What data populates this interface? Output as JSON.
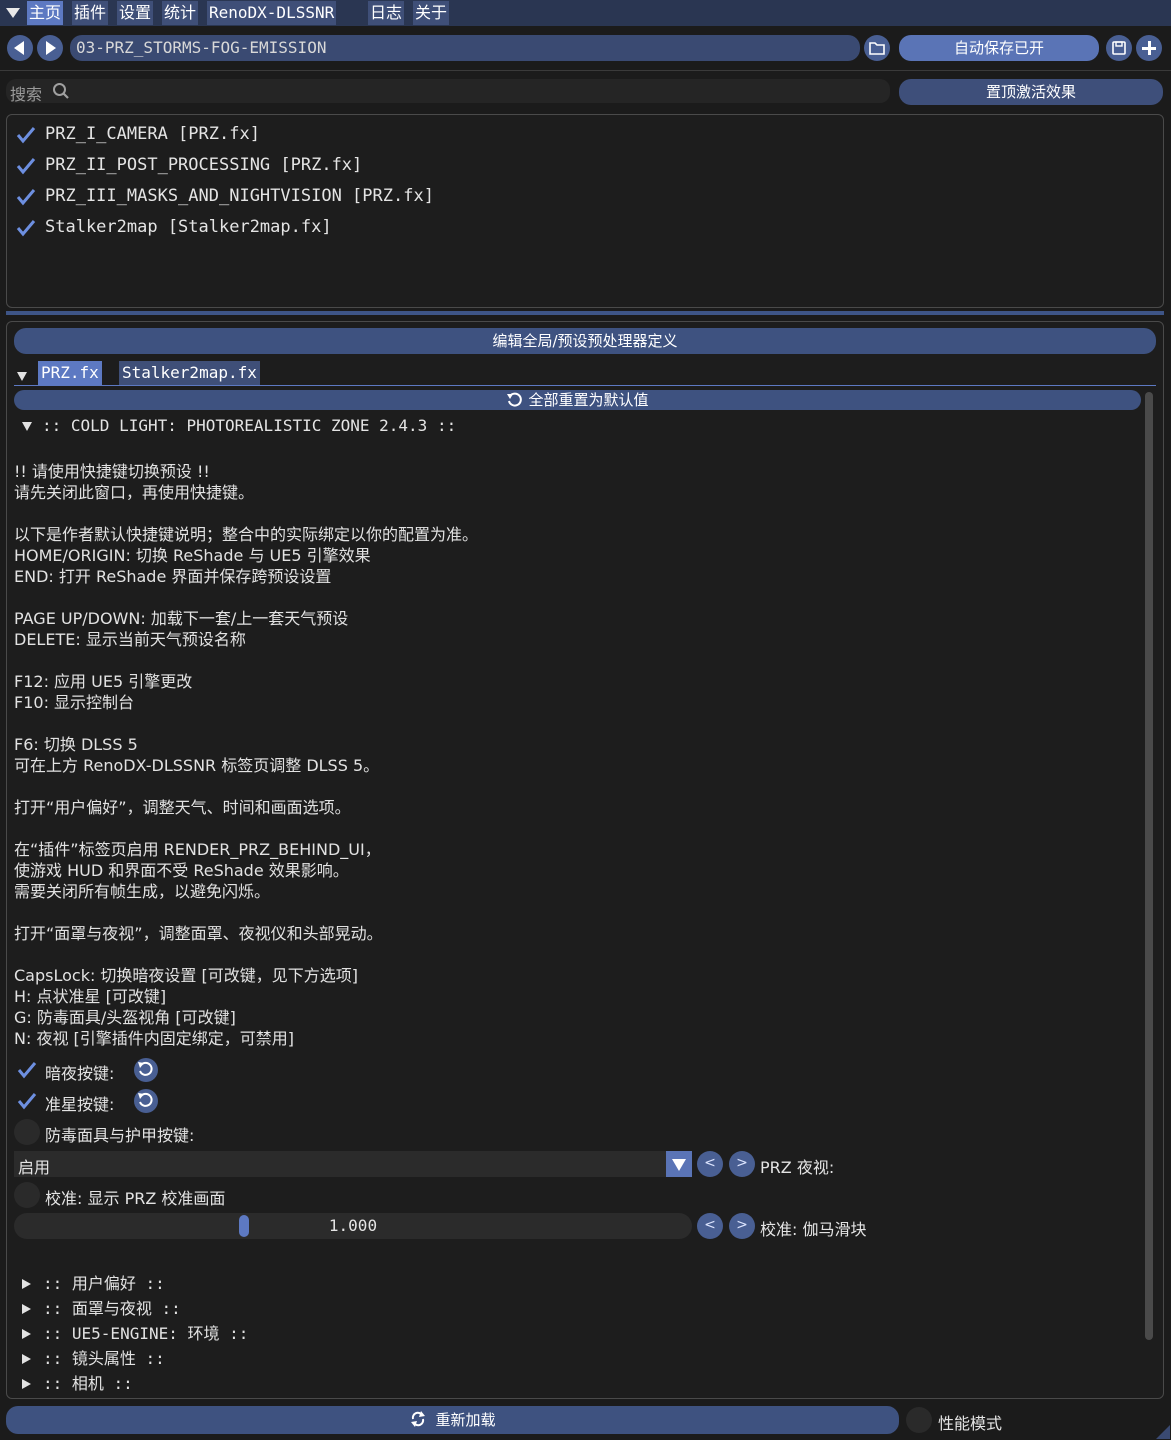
{
  "menu": {
    "tabs": [
      "主页",
      "插件",
      "设置",
      "统计",
      "RenoDX-DLSSNR",
      "日志",
      "关于"
    ],
    "active_tab": "主页"
  },
  "preset": {
    "name": "03-PRZ_STORMS-FOG-EMISSION",
    "autosave_label": "自动保存已开"
  },
  "search": {
    "label": "搜索",
    "placeholder": "",
    "pin_active_label": "置顶激活效果"
  },
  "effects": [
    {
      "label": "PRZ_I_CAMERA [PRZ.fx]",
      "checked": true
    },
    {
      "label": "PRZ_II_POST_PROCESSING [PRZ.fx]",
      "checked": true
    },
    {
      "label": "PRZ_III_MASKS_AND_NIGHTVISION [PRZ.fx]",
      "checked": true
    },
    {
      "label": "Stalker2map [Stalker2map.fx]",
      "checked": true
    }
  ],
  "editor": {
    "edit_defines_label": "编辑全局/预设预处理器定义",
    "file_tabs": [
      "PRZ.fx",
      "Stalker2map.fx"
    ],
    "active_file_tab": "PRZ.fx",
    "reset_all_label": "全部重置为默认值",
    "section_title": ":: COLD LIGHT: PHOTOREALISTIC ZONE 2.4.3 ::",
    "info_lines": [
      "!! 请使用快捷键切换预设 !!",
      "请先关闭此窗口，再使用快捷键。",
      "",
      "以下是作者默认快捷键说明；整合中的实际绑定以你的配置为准。",
      "HOME/ORIGIN: 切换 ReShade 与 UE5 引擎效果",
      "END: 打开 ReShade 界面并保存跨预设设置",
      "",
      "PAGE UP/DOWN: 加载下一套/上一套天气预设",
      "DELETE: 显示当前天气预设名称",
      "",
      "F12: 应用 UE5 引擎更改",
      "F10: 显示控制台",
      "",
      "F6: 切换 DLSS 5",
      "可在上方 RenoDX-DLSSNR 标签页调整 DLSS 5。",
      "",
      "打开“用户偏好”，调整天气、时间和画面选项。",
      "",
      "在“插件”标签页启用 RENDER_PRZ_BEHIND_UI，",
      "使游戏 HUD 和界面不受 ReShade 效果影响。",
      "需要关闭所有帧生成，以避免闪烁。",
      "",
      "打开“面罩与夜视”，调整面罩、夜视仪和头部晃动。",
      "",
      "CapsLock: 切换暗夜设置 [可改键，见下方选项]",
      "H: 点状准星 [可改键]",
      "G: 防毒面具/头盔视角 [可改键]",
      "N: 夜视 [引擎插件内固定绑定，可禁用]"
    ],
    "options": [
      {
        "label": "暗夜按键:",
        "checked": true
      },
      {
        "label": "准星按键:",
        "checked": true
      },
      {
        "label": "防毒面具与护甲按键:",
        "checked": false
      }
    ],
    "nightvision_combo": {
      "value": "启用",
      "label": "PRZ 夜视:"
    },
    "calibration_toggle": {
      "label": "校准: 显示 PRZ 校准画面",
      "checked": false
    },
    "gamma_slider": {
      "value": "1.000",
      "fraction": 0.337,
      "label": "校准: 伽马滑块"
    },
    "collapsed_sections": [
      ":: 用户偏好 ::",
      ":: 面罩与夜视 ::",
      ":: UE5-ENGINE: 环境 ::",
      ":: 镜头属性 ::",
      ":: 相机 ::"
    ]
  },
  "footer": {
    "reload_label": "重新加载",
    "performance_mode_label": "性能模式"
  },
  "colors": {
    "accent": "#5d79c2",
    "button": "#495f93",
    "background": "#1b1b1b"
  }
}
